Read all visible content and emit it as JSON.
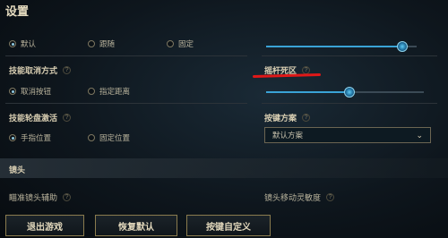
{
  "page": {
    "title": "设置"
  },
  "top_row": {
    "options": [
      {
        "label": "默认",
        "selected": true
      },
      {
        "label": "跟随",
        "selected": false
      },
      {
        "label": "固定",
        "selected": false
      }
    ],
    "slider_value": 0.9
  },
  "skill_cancel": {
    "label": "技能取消方式",
    "options": [
      {
        "label": "取消按钮",
        "selected": true
      },
      {
        "label": "指定距离",
        "selected": false
      }
    ]
  },
  "joystick_deadzone": {
    "label": "摇杆死区",
    "slider_value": 0.53
  },
  "skill_wheel": {
    "label": "技能轮盘激活",
    "options": [
      {
        "label": "手指位置",
        "selected": true
      },
      {
        "label": "固定位置",
        "selected": false
      }
    ]
  },
  "key_scheme": {
    "label": "按键方案",
    "selected": "默认方案"
  },
  "camera": {
    "section_label": "镜头",
    "aim_assist_label": "瞄准镜头辅助",
    "move_sensitivity_label": "镜头移动灵敏度"
  },
  "buttons": {
    "exit": "退出游戏",
    "restore": "恢复默认",
    "customize": "按键自定义"
  },
  "icons": {
    "help": "?",
    "chevron": "⌄"
  },
  "colors": {
    "accent_blue": "#3aa3d6",
    "annotation_red": "#e01818",
    "gold_border": "#8a7b4e"
  }
}
